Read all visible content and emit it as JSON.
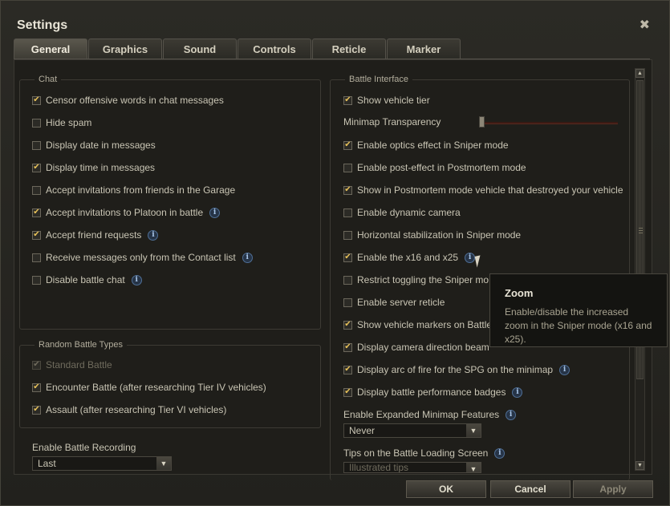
{
  "window": {
    "title": "Settings",
    "close_icon": "✖"
  },
  "tabs": [
    {
      "label": "General"
    },
    {
      "label": "Graphics"
    },
    {
      "label": "Sound"
    },
    {
      "label": "Controls"
    },
    {
      "label": "Reticle"
    },
    {
      "label": "Marker"
    }
  ],
  "chat": {
    "legend": "Chat",
    "options": [
      {
        "label": "Censor offensive words in chat messages",
        "checked": true
      },
      {
        "label": "Hide spam",
        "checked": false
      },
      {
        "label": "Display date in messages",
        "checked": false
      },
      {
        "label": "Display time in messages",
        "checked": true
      },
      {
        "label": "Accept invitations from friends in the Garage",
        "checked": false
      },
      {
        "label": "Accept invitations to Platoon in battle",
        "checked": true
      },
      {
        "label": "Accept friend requests",
        "checked": true
      },
      {
        "label": "Receive messages only from the Contact list",
        "checked": false
      },
      {
        "label": "Disable battle chat",
        "checked": false
      }
    ]
  },
  "random_battle": {
    "legend": "Random Battle Types",
    "options": [
      {
        "label": "Standard Battle",
        "checked": true
      },
      {
        "label": "Encounter Battle (after researching Tier IV vehicles)",
        "checked": true
      },
      {
        "label": "Assault (after researching Tier VI vehicles)",
        "checked": true
      }
    ]
  },
  "recording": {
    "label": "Enable Battle Recording",
    "value": "Last"
  },
  "battle_interface": {
    "legend": "Battle Interface",
    "show_tier": {
      "label": "Show vehicle tier",
      "checked": true
    },
    "minimap_transparency": {
      "label": "Minimap Transparency",
      "value": 0
    },
    "options": [
      {
        "label": "Enable optics effect in Sniper mode",
        "checked": true
      },
      {
        "label": "Enable post-effect in Postmortem mode",
        "checked": false
      },
      {
        "label": "Show in Postmortem mode vehicle that destroyed your vehicle",
        "checked": true
      },
      {
        "label": "Enable dynamic camera",
        "checked": false
      },
      {
        "label": "Horizontal stabilization in Sniper mode",
        "checked": false
      },
      {
        "label": "Enable the x16 and x25",
        "checked": true
      },
      {
        "label": "Restrict toggling the Sniper mo",
        "checked": false
      },
      {
        "label": "Enable server reticle",
        "checked": false
      },
      {
        "label": "Show vehicle markers on Battle",
        "checked": true
      },
      {
        "label": "Display camera direction beam",
        "checked": true
      },
      {
        "label": "Display arc of fire for the SPG on the minimap",
        "checked": true
      },
      {
        "label": "Display battle performance badges",
        "checked": true
      }
    ],
    "expanded_minimap": {
      "label": "Enable Expanded Minimap Features",
      "value": "Never"
    },
    "tips": {
      "label": "Tips on the Battle Loading Screen",
      "value": "Illustrated tips"
    }
  },
  "tooltip": {
    "title": "Zoom",
    "body": "Enable/disable the increased zoom in the Sniper mode (x16 and x25)."
  },
  "buttons": {
    "ok": "OK",
    "cancel": "Cancel",
    "apply": "Apply"
  },
  "icons": {
    "info": "i",
    "check": "✔",
    "dropdown": "▼",
    "scroll_up": "▲",
    "scroll_down": "▼"
  }
}
